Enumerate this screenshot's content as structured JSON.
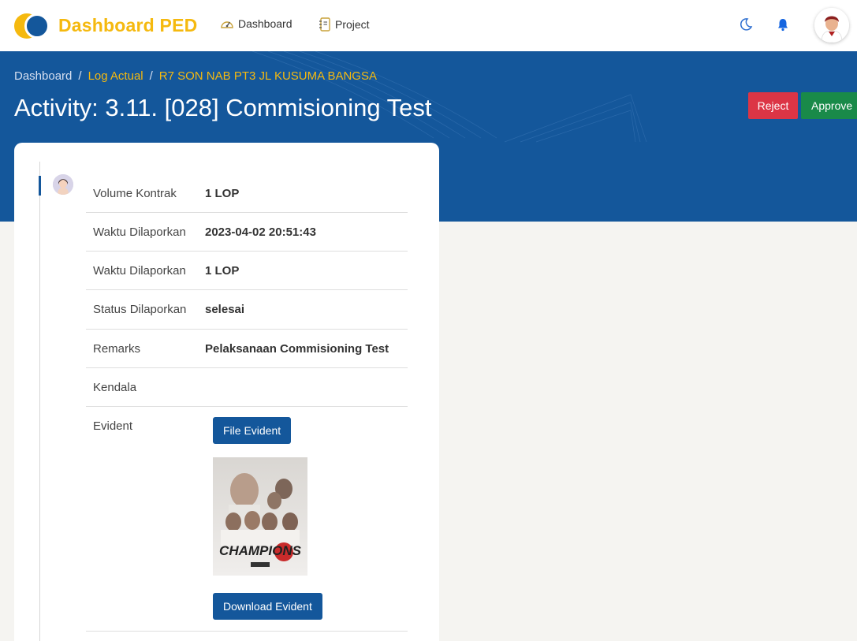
{
  "navbar": {
    "brand": "Dashboard PED",
    "links": [
      {
        "label": "Dashboard",
        "icon": "speedometer-icon"
      },
      {
        "label": "Project",
        "icon": "notebook-icon"
      }
    ],
    "icons": [
      "moon-icon",
      "bell-icon"
    ],
    "avatar": "user-avatar"
  },
  "hero": {
    "breadcrumb": [
      "Dashboard",
      "Log Actual",
      "R7 SON NAB PT3 JL KUSUMA BANGSA"
    ],
    "title": "Activity: 3.11. [028] Commisioning Test",
    "reject_label": "Reject",
    "approve_label": "Approve"
  },
  "details": [
    {
      "label": "Volume Kontrak",
      "value": "1 LOP"
    },
    {
      "label": "Waktu Dilaporkan",
      "value": "2023-04-02 20:51:43"
    },
    {
      "label": "Waktu Dilaporkan",
      "value": "1 LOP"
    },
    {
      "label": "Status Dilaporkan",
      "value": "selesai"
    },
    {
      "label": "Remarks",
      "value": "Pelaksanaan Commisioning Test"
    },
    {
      "label": "Kendala",
      "value": ""
    },
    {
      "label": "Evident",
      "value": ""
    }
  ],
  "evident": {
    "file_button": "File Evident",
    "download_button": "Download Evident",
    "poster_text": "CHAMPIONS"
  },
  "colors": {
    "primary": "#14579b",
    "accent": "#f5b90f",
    "danger": "#dc3545",
    "success": "#198a49"
  }
}
